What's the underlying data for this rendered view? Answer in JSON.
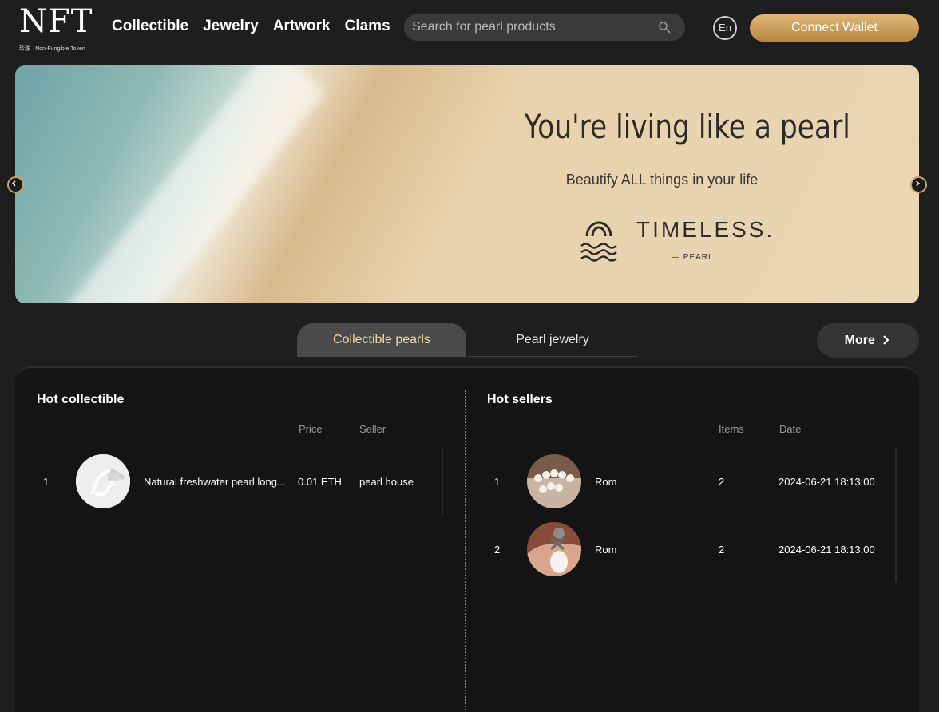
{
  "header": {
    "logo_text": "NFT",
    "logo_subtext": "珍珠 · Non-Fungible Token",
    "nav": [
      "Collectible",
      "Jewelry",
      "Artwork",
      "Clams"
    ],
    "search_placeholder": "Search for pearl products",
    "lang": "En",
    "wallet_button": "Connect Wallet"
  },
  "banner": {
    "title": "You're living like a pearl",
    "subtitle": "Beautify ALL things in your life",
    "brand": "TIMELESS.",
    "brand_sub": "— PEARL"
  },
  "tabs": {
    "active": "Collectible pearls",
    "inactive": "Pearl jewelry",
    "more": "More"
  },
  "hot_collectible": {
    "title": "Hot collectible",
    "columns": [
      "Price",
      "Seller"
    ],
    "rows": [
      {
        "rank": "1",
        "name": "Natural freshwater pearl long...",
        "price": "0.01 ETH",
        "seller": "pearl house"
      }
    ]
  },
  "hot_sellers": {
    "title": "Hot sellers",
    "columns": [
      "Items",
      "Date"
    ],
    "rows": [
      {
        "rank": "1",
        "name": "Rom",
        "items": "2",
        "date": "2024-06-21 18:13:00"
      },
      {
        "rank": "2",
        "name": "Rom",
        "items": "2",
        "date": "2024-06-21 18:13:00"
      }
    ]
  },
  "colors": {
    "accent_gold": "#c99a55",
    "tab_active_text": "#f0d9a4",
    "background": "#1e1e1e",
    "panel": "#141414"
  }
}
